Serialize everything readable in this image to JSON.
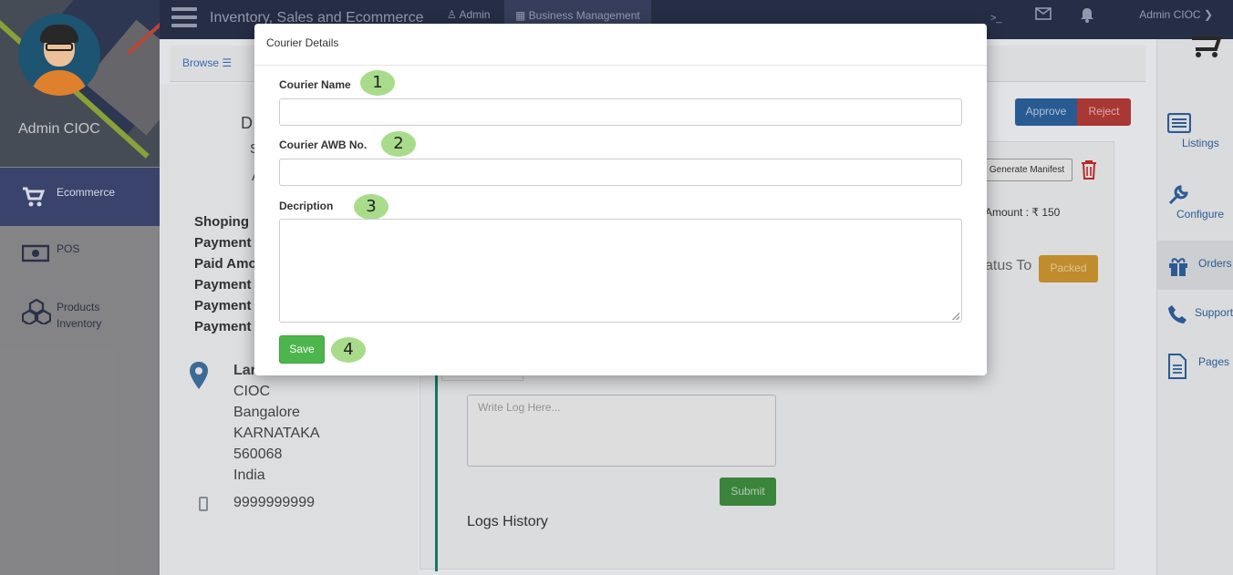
{
  "sidebar": {
    "profile_name": "Admin CIOC",
    "items": [
      {
        "label": "Ecommerce",
        "icon": "cart-icon"
      },
      {
        "label": "POS",
        "icon": "money-icon"
      },
      {
        "label": "Products Inventory",
        "icon": "cubes-icon"
      }
    ]
  },
  "topbar": {
    "title": "Inventory, Sales and Ecommerce",
    "admin_link": "Admin",
    "business_link": "Business Management",
    "terminal_glyph": ">_",
    "user": "Admin CIOC"
  },
  "content": {
    "browse": "Browse",
    "heading_letter": "D",
    "heading_s": "S",
    "heading_a": "A",
    "info_lines": [
      "Shoping",
      "Payment",
      "Paid Amo",
      "Payment",
      "Payment",
      "Payment"
    ],
    "address_name": "Lar",
    "address_lines": [
      "CIOC",
      "Bangalore",
      "KARNATAKA",
      "560068",
      "India"
    ],
    "phone": "9999999999",
    "approve": "Approve",
    "reject": "Reject",
    "generate_manifest": "Generate Manifest",
    "amount": "Amount : ₹ 150",
    "status_to": "atus To",
    "packed": "Packed",
    "log_placeholder": "Write Log Here...",
    "submit": "Submit",
    "logs_history": "Logs History"
  },
  "right_sidebar": {
    "items": [
      {
        "label": "Listings",
        "icon": "list-icon"
      },
      {
        "label": "Configure",
        "icon": "wrench-icon"
      },
      {
        "label": "Orders",
        "icon": "gift-icon"
      },
      {
        "label": "Support",
        "icon": "phone-icon"
      },
      {
        "label": "Pages",
        "icon": "document-icon"
      }
    ]
  },
  "modal": {
    "title": "Courier Details",
    "courier_name_label": "Courier Name",
    "courier_name_value": "",
    "awb_label": "Courier AWB No.",
    "awb_value": "",
    "description_label": "Decription",
    "description_value": "",
    "save": "Save",
    "badges": [
      "1",
      "2",
      "3",
      "4"
    ]
  },
  "colors": {
    "topbar": "#283049",
    "active_nav": "#3d4670",
    "save_button": "#4cb64c",
    "badge": "#a8dc8a"
  }
}
